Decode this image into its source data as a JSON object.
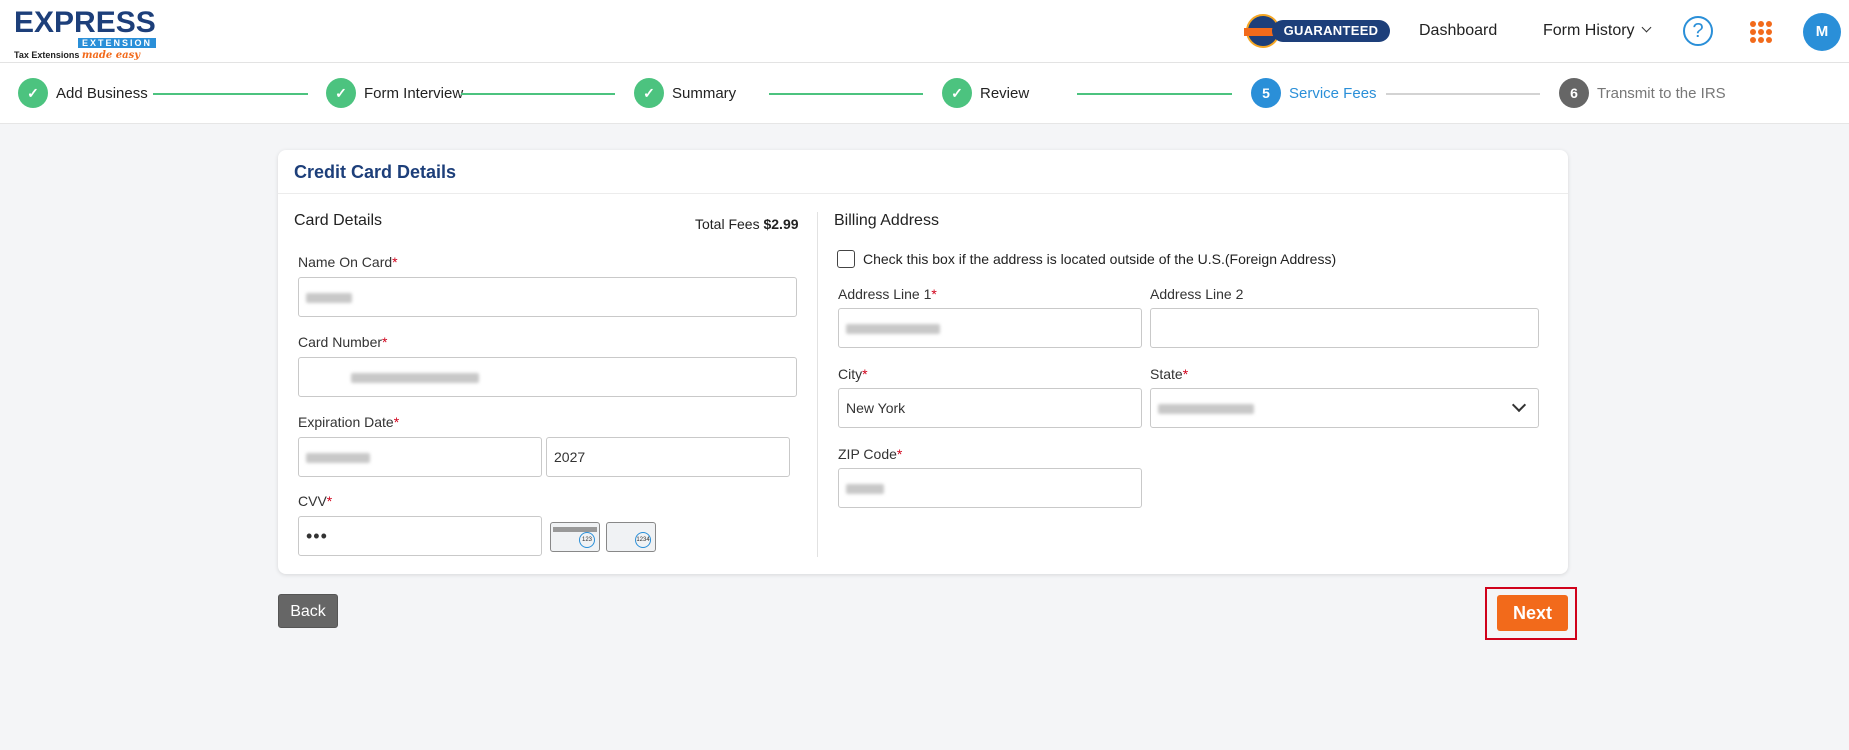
{
  "header": {
    "logo_main": "EXPRESS",
    "logo_sub": "EXTENSION",
    "logo_tagline": "Tax Extensions",
    "logo_tagline_script": "made easy",
    "guaranteed_label": "GUARANTEED",
    "dashboard_link": "Dashboard",
    "form_history_link": "Form History",
    "help_glyph": "?",
    "avatar_initial": "M"
  },
  "stepper": [
    {
      "number": "✓",
      "label": "Add Business",
      "state": "done"
    },
    {
      "number": "✓",
      "label": "Form Interview",
      "state": "done"
    },
    {
      "number": "✓",
      "label": "Summary",
      "state": "done"
    },
    {
      "number": "✓",
      "label": "Review",
      "state": "done"
    },
    {
      "number": "5",
      "label": "Service Fees",
      "state": "active"
    },
    {
      "number": "6",
      "label": "Transmit to the IRS",
      "state": "pending"
    }
  ],
  "card": {
    "title": "Credit Card Details",
    "card_details": {
      "heading": "Card Details",
      "total_fees_label": "Total Fees",
      "total_fees_value": "$2.99",
      "name_on_card_label": "Name On Card",
      "card_number_label": "Card Number",
      "expiration_label": "Expiration Date",
      "expiration_year": "2027",
      "cvv_label": "CVV",
      "cvv_value": "•••",
      "card_img_1_text": "123",
      "card_img_2_text": "1234"
    },
    "billing": {
      "heading": "Billing Address",
      "foreign_checkbox_label": "Check this box if the address is located outside of the U.S.(Foreign Address)",
      "address1_label": "Address Line 1",
      "address2_label": "Address Line 2",
      "city_label": "City",
      "city_value": "New York",
      "state_label": "State",
      "zip_label": "ZIP Code"
    },
    "required_mark": "*"
  },
  "actions": {
    "back_label": "Back",
    "next_label": "Next"
  },
  "colors": {
    "brand_navy": "#1d3f7a",
    "brand_blue": "#2a8fd8",
    "accent_orange": "#f26a1b",
    "step_done_green": "#4cc37f",
    "highlight_red": "#d0021b"
  }
}
